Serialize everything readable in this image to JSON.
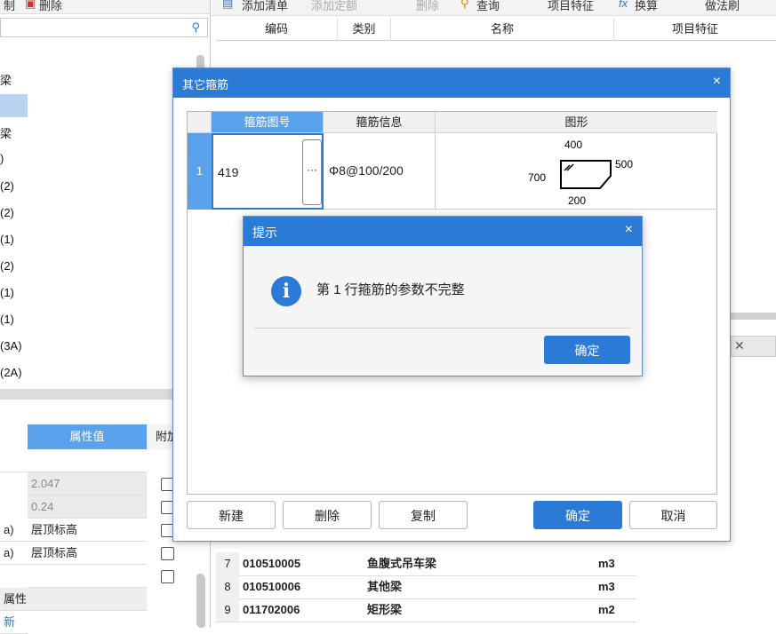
{
  "left_toolbar": {
    "items": [
      "制",
      "删除"
    ]
  },
  "left_tree": {
    "items": [
      "梁",
      "",
      "梁",
      ")",
      "(2)",
      "(2)",
      "(1)",
      "(2)",
      "(1)",
      "(1)",
      "(3A)",
      "(2A)"
    ]
  },
  "props": {
    "header_value": "属性值",
    "header_extra": "附加",
    "rows": [
      {
        "name": "",
        "value": "2.047"
      },
      {
        "name": "",
        "value": "0.24"
      },
      {
        "name": "a)",
        "value": "层顶标高"
      },
      {
        "name": "a)",
        "value": "层顶标高"
      },
      {
        "name": "",
        "value": ""
      },
      {
        "name": "属性",
        "value": ""
      },
      {
        "name": "新",
        "value": ""
      }
    ]
  },
  "right_toolbar": {
    "items": [
      "添加清单",
      "添加定额",
      "删除",
      "查询",
      "项目特征",
      "换算",
      "做法刷"
    ]
  },
  "grid": {
    "headers": [
      "编码",
      "类别",
      "名称",
      "项目特征"
    ]
  },
  "list_rows": [
    {
      "num": "7",
      "code": "010510005",
      "name": "鱼腹式吊车梁",
      "unit": "m3"
    },
    {
      "num": "8",
      "code": "010510006",
      "name": "其他梁",
      "unit": "m3"
    },
    {
      "num": "9",
      "code": "011702006",
      "name": "矩形梁",
      "unit": "m2"
    }
  ],
  "dialog": {
    "title": "其它箍筋",
    "close": "×",
    "table": {
      "headers": [
        "箍筋图号",
        "箍筋信息",
        "图形"
      ],
      "row": {
        "num": "1",
        "code": "419",
        "ellipsis": "···",
        "info": "Φ8@100/200"
      },
      "shape_labels": {
        "top": "400",
        "left": "700",
        "right": "500",
        "bottom": "200"
      }
    },
    "buttons": {
      "new": "新建",
      "delete": "删除",
      "copy": "复制",
      "ok": "确定",
      "cancel": "取消"
    }
  },
  "message": {
    "title": "提示",
    "close": "×",
    "icon": "info-icon",
    "text": "第 1 行箍筋的参数不完整",
    "ok": "确定"
  },
  "colors": {
    "accent": "#2a7ad6",
    "header_active": "#5aa2ec"
  }
}
